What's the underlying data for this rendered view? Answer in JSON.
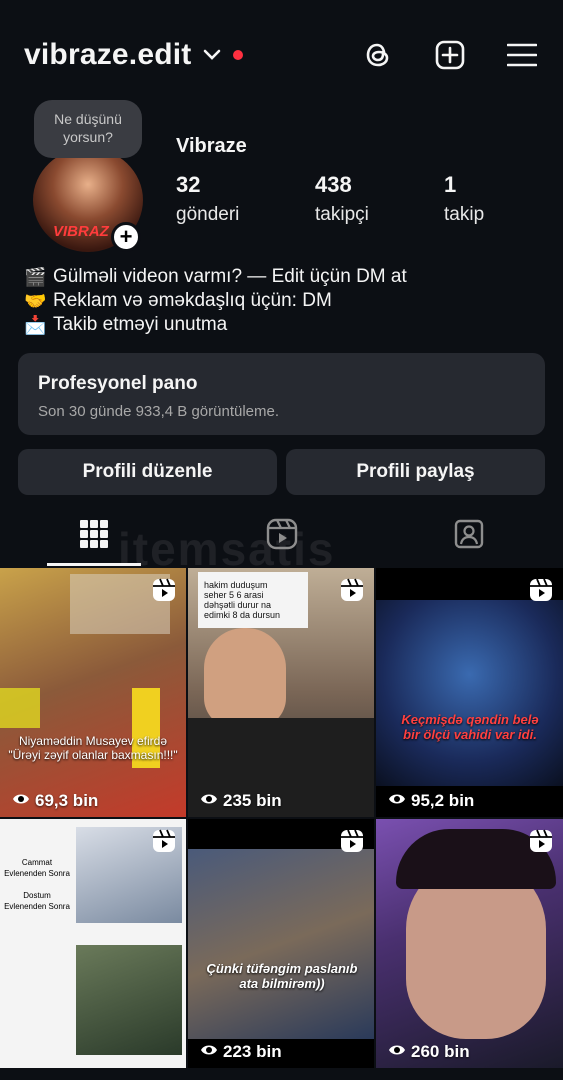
{
  "header": {
    "username": "vibraze.edit",
    "icons": [
      "chevron-down-icon",
      "threads-icon",
      "add-post-icon",
      "menu-icon"
    ]
  },
  "profile": {
    "note": "Ne düşünü\nyorsun?",
    "avatar_text": "VIBRAZ",
    "display_name": "Vibraze",
    "stats": [
      {
        "value": "32",
        "label": "gönderi"
      },
      {
        "value": "438",
        "label": "takipçi"
      },
      {
        "value": "1",
        "label": "takip"
      }
    ],
    "bio": [
      {
        "icon": "🎬",
        "text": "Gülməli videon varmı? — Edit üçün DM at"
      },
      {
        "icon": "🤝",
        "text": "Reklam və əməkdaşlıq üçün: DM"
      },
      {
        "icon": "📩",
        "text": "Takib etməyi unutma"
      }
    ]
  },
  "pro_panel": {
    "title": "Profesyonel pano",
    "subtitle": "Son 30 günde 933,4 B görüntüleme."
  },
  "buttons": {
    "edit": "Profili düzenle",
    "share": "Profili paylaş"
  },
  "tabs": [
    "grid-icon",
    "reels-icon",
    "tagged-icon"
  ],
  "watermark": "itemsatis",
  "posts": [
    {
      "views": "69,3 bin",
      "caption": "Niyaməddin Musayev efirdə\n\"Ürəyi zəyif olanlar baxmasın!!!\"",
      "bg": "#8a6a3a"
    },
    {
      "views": "235 bin",
      "caption": "hakim duduşum\nseher 5 6 arasi\ndəhşətli durur na\nedimki 8 da dursun",
      "bg": "#5a4a40"
    },
    {
      "views": "95,2 bin",
      "caption": "Keçmişdə qəndin belə\nbir ölçü vahidi var idi.",
      "bg": "#1b3a6a"
    },
    {
      "views": "",
      "caption": "Cammat\nEvlenenden Sonra\n\nDostum\nEvlenenden Sonra",
      "bg": "#f2f2f2"
    },
    {
      "views": "223 bin",
      "caption": "Çünki tüfəngim paslanıb\nata bilmirəm))",
      "bg": "#3a4a6a"
    },
    {
      "views": "260 bin",
      "caption": "",
      "bg": "#6a4a9a"
    }
  ]
}
